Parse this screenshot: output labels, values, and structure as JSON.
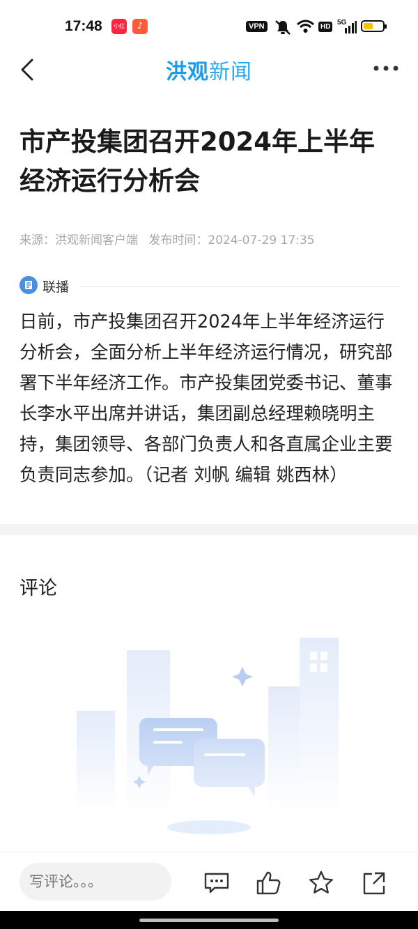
{
  "status_bar": {
    "time": "17:48",
    "app_badge_1": "小红书",
    "app_badge_2": "♪",
    "vpn": "VPN",
    "hd": "HD",
    "network": "5G",
    "battery_level": 0.35,
    "battery_color": "#f5c400"
  },
  "nav": {
    "logo_bold": "洪观",
    "logo_light": "新闻",
    "brand_color": "#1b9be6"
  },
  "article": {
    "title": "市产投集团召开2024年上半年经济运行分析会",
    "source": "来源：洪观新闻客户端",
    "publish_time": "发布时间：2024-07-29 17:35",
    "lianbo_label": "联播",
    "body": "日前，市产投集团召开2024年上半年经济运行分析会，全面分析上半年经济运行情况，研究部署下半年经济工作。市产投集团党委书记、董事长李水平出席并讲话，集团副总经理赖晓明主持，集团领导、各部门负责人和各直属企业主要负责同志参加。（记者 刘帆 编辑 姚西林）"
  },
  "comments": {
    "title": "评论"
  },
  "bottom_bar": {
    "comment_placeholder": "写评论。。。",
    "icons": [
      "comment-icon",
      "like-icon",
      "star-icon",
      "share-icon"
    ]
  }
}
